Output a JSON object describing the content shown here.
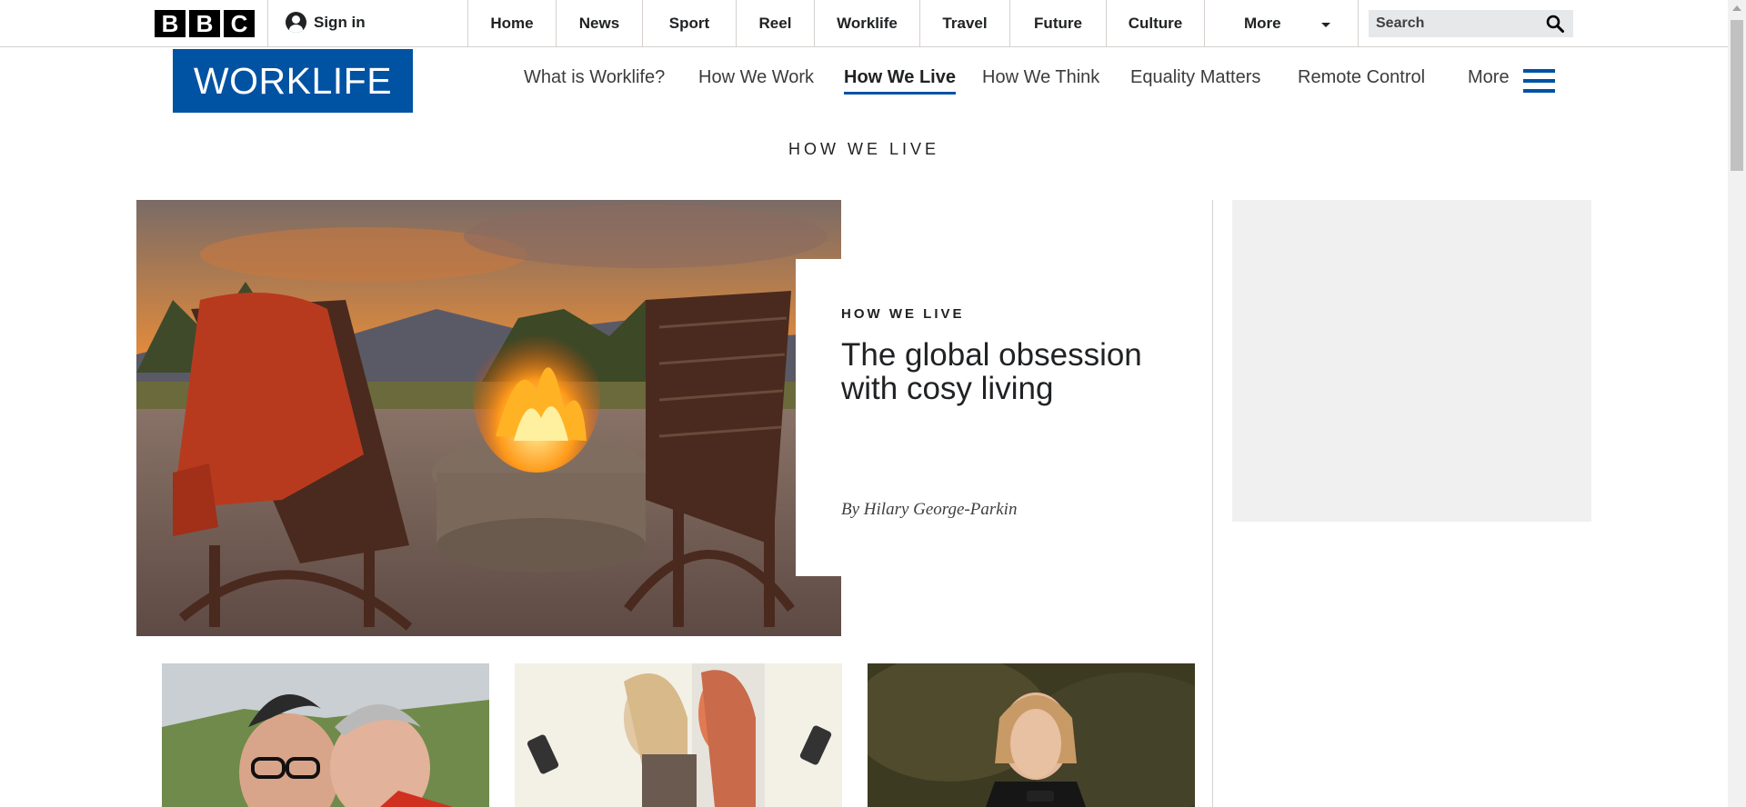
{
  "topbar": {
    "logo_letters": [
      "B",
      "B",
      "C"
    ],
    "signin_label": "Sign in",
    "nav": [
      "Home",
      "News",
      "Sport",
      "Reel",
      "Worklife",
      "Travel",
      "Future",
      "Culture"
    ],
    "more_label": "More",
    "search_placeholder": "Search"
  },
  "worklife": {
    "logo_text": "WORKLIFE",
    "nav": [
      {
        "label": "What is Worklife?",
        "active": false
      },
      {
        "label": "How We Work",
        "active": false
      },
      {
        "label": "How We Live",
        "active": true
      },
      {
        "label": "How We Think",
        "active": false
      },
      {
        "label": "Equality Matters",
        "active": false
      },
      {
        "label": "Remote Control",
        "active": false
      },
      {
        "label": "More",
        "active": false
      }
    ]
  },
  "section_title": "HOW WE LIVE",
  "hero": {
    "kicker": "HOW WE LIVE",
    "title": "The global obsession with cosy living",
    "byline": "By Hilary George-Parkin"
  },
  "colors": {
    "brand_blue": "#0052a3",
    "text_dark": "#202224",
    "divider": "#d5d0cd",
    "ad_bg": "#f0f0f0"
  },
  "icons": [
    "bbc-logo",
    "user-icon",
    "caret-down-icon",
    "search-icon",
    "hamburger-icon"
  ]
}
